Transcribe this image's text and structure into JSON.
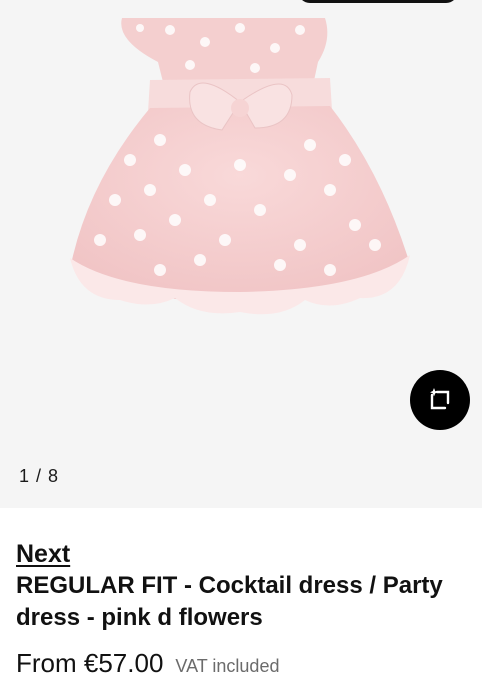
{
  "gallery": {
    "counter": "1 / 8",
    "view_similar_icon": "view-similar-icon"
  },
  "product": {
    "brand": "Next",
    "title": "REGULAR FIT - Cocktail dress / Party dress - pink d flowers",
    "price": "From €57.00",
    "vat_note": "VAT included"
  },
  "colors": {
    "background": "#ffffff",
    "gallery_bg": "#f5f5f5",
    "dress_pink": "#f6cfd0",
    "button_bg": "#000000"
  }
}
